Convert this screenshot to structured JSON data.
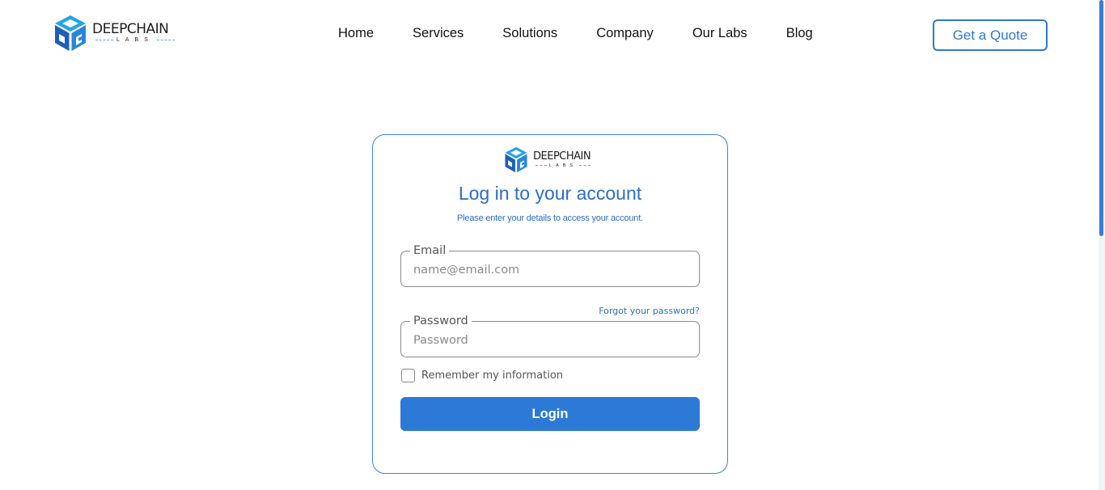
{
  "header": {
    "logo": {
      "name": "DEEPCHAIN",
      "sub": "LABS"
    },
    "nav": [
      "Home",
      "Services",
      "Solutions",
      "Company",
      "Our Labs",
      "Blog"
    ],
    "cta_label": "Get a Quote"
  },
  "card": {
    "logo": {
      "name": "DEEPCHAIN",
      "sub": "LABS"
    },
    "title": "Log in to your account",
    "subtitle": "Please enter your details to access your account.",
    "email": {
      "label": "Email",
      "placeholder": "name@email.com",
      "value": ""
    },
    "forgot_label": "Forgot your password?",
    "password": {
      "label": "Password",
      "placeholder": "Password",
      "value": ""
    },
    "remember_label": "Remember my information",
    "remember_checked": false,
    "login_label": "Login"
  },
  "colors": {
    "brand_blue": "#2d7ad6",
    "logo_blue_light": "#23a4e8",
    "logo_blue_dark": "#1d5fb8"
  }
}
